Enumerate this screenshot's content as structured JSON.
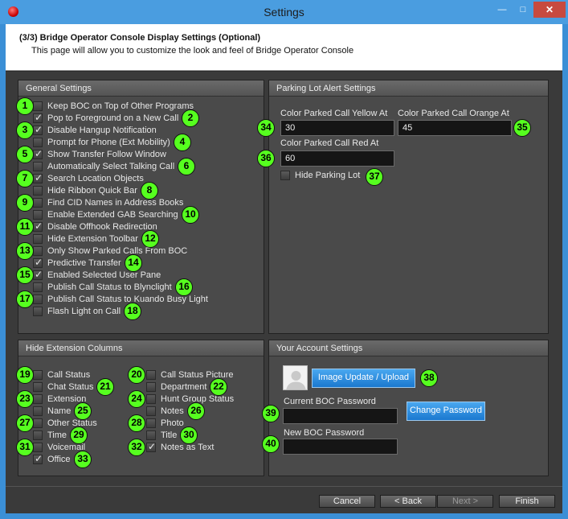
{
  "window": {
    "title": "Settings",
    "minimize_glyph": "—",
    "maximize_glyph": "□",
    "close_glyph": "✕"
  },
  "header": {
    "title": "(3/3) Bridge Operator Console Display Settings (Optional)",
    "subtitle": "This page will allow you to customize the look and feel of Bridge Operator Console"
  },
  "general_settings": {
    "title": "General Settings",
    "items": [
      {
        "label": "Keep BOC on Top of Other Programs",
        "checked": false,
        "badge": "1"
      },
      {
        "label": "Pop to Foreground on a New Call",
        "checked": true,
        "badge": "2"
      },
      {
        "label": "Disable Hangup Notification",
        "checked": true,
        "badge": "3"
      },
      {
        "label": "Prompt for Phone (Ext Mobility)",
        "checked": false,
        "badge": "4"
      },
      {
        "label": "Show Transfer Follow Window",
        "checked": true,
        "badge": "5"
      },
      {
        "label": "Automatically Select Talking Call",
        "checked": false,
        "badge": "6"
      },
      {
        "label": "Search Location Objects",
        "checked": true,
        "badge": "7"
      },
      {
        "label": "Hide Ribbon Quick Bar",
        "checked": false,
        "badge": "8"
      },
      {
        "label": "Find CID Names in Address Books",
        "checked": false,
        "badge": "9"
      },
      {
        "label": "Enable Extended GAB Searching",
        "checked": false,
        "badge": "10"
      },
      {
        "label": "Disable Offhook Redirection",
        "checked": true,
        "badge": "11"
      },
      {
        "label": "Hide Extension Toolbar",
        "checked": false,
        "badge": "12"
      },
      {
        "label": "Only Show Parked Calls From BOC",
        "checked": false,
        "badge": "13"
      },
      {
        "label": "Predictive Transfer",
        "checked": true,
        "badge": "14"
      },
      {
        "label": "Enabled Selected User Pane",
        "checked": true,
        "badge": "15"
      },
      {
        "label": "Publish Call Status to Blynclight",
        "checked": false,
        "badge": "16"
      },
      {
        "label": "Publish Call Status to Kuando Busy Light",
        "checked": false,
        "badge": "17"
      },
      {
        "label": "Flash Light on Call",
        "checked": false,
        "badge": "18"
      }
    ]
  },
  "parking_lot": {
    "title": "Parking Lot Alert Settings",
    "yellow_label": "Color Parked Call Yellow At",
    "yellow_value": "30",
    "yellow_badge": "34",
    "orange_label": "Color Parked Call Orange At",
    "orange_value": "45",
    "orange_badge": "35",
    "red_label": "Color Parked Call Red At",
    "red_value": "60",
    "red_badge": "36",
    "hide_label": "Hide Parking Lot",
    "hide_checked": false,
    "hide_badge": "37"
  },
  "hide_columns": {
    "title": "Hide Extension Columns",
    "left": [
      {
        "label": "Call Status",
        "checked": false,
        "badge": "19"
      },
      {
        "label": "Chat Status",
        "checked": false,
        "badge": "21"
      },
      {
        "label": "Extension",
        "checked": false,
        "badge": "23"
      },
      {
        "label": "Name",
        "checked": false,
        "badge": "25"
      },
      {
        "label": "Other Status",
        "checked": false,
        "badge": "27"
      },
      {
        "label": "Time",
        "checked": false,
        "badge": "29"
      },
      {
        "label": "Voicemail",
        "checked": false,
        "badge": "31"
      },
      {
        "label": "Office",
        "checked": true,
        "badge": "33"
      }
    ],
    "right": [
      {
        "label": "Call Status Picture",
        "checked": false,
        "badge": "20"
      },
      {
        "label": "Department",
        "checked": false,
        "badge": "22"
      },
      {
        "label": "Hunt Group Status",
        "checked": false,
        "badge": "24"
      },
      {
        "label": "Notes",
        "checked": false,
        "badge": "26"
      },
      {
        "label": "Photo",
        "checked": false,
        "badge": "28"
      },
      {
        "label": "Title",
        "checked": false,
        "badge": "30"
      },
      {
        "label": "Notes as Text",
        "checked": true,
        "badge": "32"
      }
    ]
  },
  "account": {
    "title": "Your Account Settings",
    "image_button": "Image Update / Upload",
    "image_badge": "38",
    "current_password_label": "Current BOC Password",
    "current_password_value": "",
    "current_badge": "39",
    "change_password_button": "Change Password",
    "new_password_label": "New BOC Password",
    "new_password_value": "",
    "new_badge": "40"
  },
  "footer": {
    "cancel": "Cancel",
    "back": "< Back",
    "next": "Next >",
    "finish": "Finish"
  },
  "colors": {
    "badge": "#56ff1f",
    "accent_blue": "#1a78cf",
    "titlebar": "#4a9de0",
    "close_button": "#c74a3f"
  }
}
